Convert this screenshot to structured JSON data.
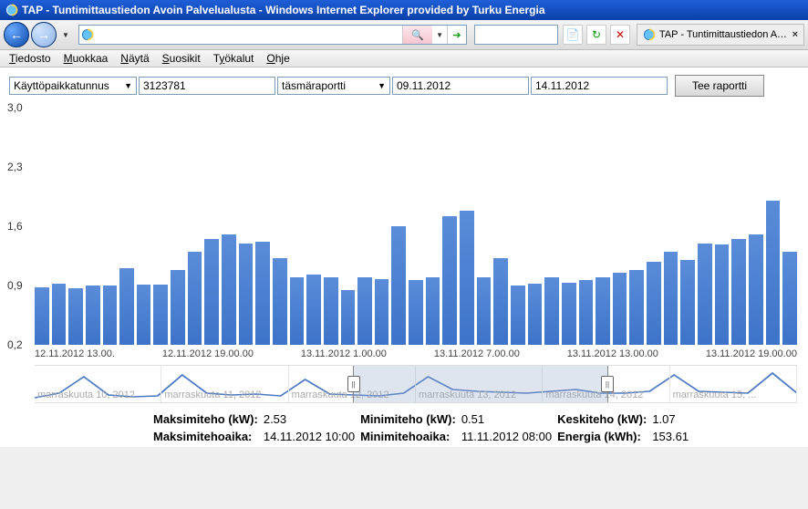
{
  "window": {
    "title": "TAP - Tuntimittaustiedon Avoin Palvelualusta - Windows Internet Explorer provided by Turku Energia",
    "tab": "TAP - Tuntimittaustiedon Av..."
  },
  "menu": {
    "tiedosto": "Tiedosto",
    "muokkaa": "Muokkaa",
    "nayta": "Näytä",
    "suosikit": "Suosikit",
    "tyokalut": "Työkalut",
    "ohje": "Ohje"
  },
  "controls": {
    "selector_label": "Käyttöpaikkatunnus",
    "selector_value": "3123781",
    "report_type": "täsmäraportti",
    "date_from": "09.11.2012",
    "date_to": "14.11.2012",
    "button": "Tee raportti"
  },
  "chart_data": {
    "type": "bar",
    "title": "",
    "ylabel": "",
    "ylim": [
      0.2,
      3.0
    ],
    "y_ticks": [
      "3,0",
      "2,3",
      "1,6",
      "0,9",
      "0,2"
    ],
    "x_ticks": [
      "12.11.2012 13.00.",
      "12.11.2012 19.00.00",
      "13.11.2012 1.00.00",
      "13.11.2012 7.00.00",
      "13.11.2012 13.00.00",
      "13.11.2012 19.00.00"
    ],
    "values": [
      0.88,
      0.92,
      0.87,
      0.9,
      0.9,
      1.1,
      0.91,
      0.91,
      1.08,
      1.3,
      1.45,
      1.5,
      1.4,
      1.42,
      1.22,
      1.0,
      1.03,
      1.0,
      0.85,
      1.0,
      0.98,
      1.6,
      0.97,
      1.0,
      1.72,
      1.78,
      1.0,
      1.22,
      0.9,
      0.92,
      1.0,
      0.93,
      0.96,
      1.0,
      1.05,
      1.08,
      1.18,
      1.3,
      1.2,
      1.4,
      1.38,
      1.45,
      1.5,
      1.9,
      1.3
    ]
  },
  "range": {
    "labels": [
      "marraskuuta 10, 2012",
      "marraskuuta 11, 2012",
      "marraskuuta 12, 2012",
      "marraskuuta 13, 2012",
      "marraskuuta 14, 2012",
      "marraskuuta 15, ..."
    ],
    "sel_start_pct": 41.7,
    "sel_end_pct": 75.0,
    "prefix": "marrask"
  },
  "stats": {
    "max_kw_label": "Maksimiteho (kW):",
    "max_kw": "2.53",
    "min_kw_label": "Minimiteho (kW):",
    "min_kw": "0.51",
    "avg_kw_label": "Keskiteho (kW):",
    "avg_kw": "1.07",
    "max_time_label": "Maksimitehoaika:",
    "max_time": "14.11.2012 10:00",
    "min_time_label": "Minimitehoaika:",
    "min_time": "11.11.2012 08:00",
    "energy_label": "Energia (kWh):",
    "energy": "153.61"
  }
}
